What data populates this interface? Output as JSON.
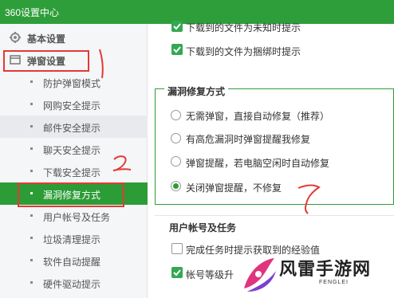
{
  "window": {
    "title": "360设置中心"
  },
  "sidebar": {
    "groups": [
      {
        "label": "基本设置",
        "icon": "gear-icon"
      },
      {
        "label": "弹窗设置",
        "icon": "window-icon"
      }
    ],
    "items": [
      {
        "label": "防护弹窗模式"
      },
      {
        "label": "网购安全提示"
      },
      {
        "label": "邮件安全提示"
      },
      {
        "label": "聊天安全提示"
      },
      {
        "label": "下载安全提示"
      },
      {
        "label": "漏洞修复方式"
      },
      {
        "label": "用户帐号及任务"
      },
      {
        "label": "垃圾清理提示"
      },
      {
        "label": "软件自动提醒"
      },
      {
        "label": "硬件驱动提示"
      }
    ],
    "active_index": 5
  },
  "main": {
    "download_options": [
      {
        "label": "下载到的文件为未知时提示",
        "checked": true
      },
      {
        "label": "下载到的文件为捆绑时提示",
        "checked": true
      }
    ],
    "vuln_section": {
      "title": "漏洞修复方式",
      "options": [
        {
          "label": "无需弹窗，直接自动修复（推荐）",
          "selected": false
        },
        {
          "label": "有高危漏洞时弹窗提醒我修复",
          "selected": false
        },
        {
          "label": "弹窗提醒，若电脑空闲时自动修复",
          "selected": false
        },
        {
          "label": "关闭弹窗提醒，不修复",
          "selected": true
        }
      ]
    },
    "account_section": {
      "title": "用户帐号及任务",
      "options": [
        {
          "label": "完成任务时提示获取到的经验值",
          "checked": false
        },
        {
          "label": "帐号等级升",
          "checked": true
        }
      ]
    }
  },
  "annotations": {
    "mark_1": "1",
    "mark_2": "2"
  },
  "watermark": {
    "text": "风雷手游网",
    "sub": "FENGLEI"
  },
  "colors": {
    "brand_green": "#2e9e3a",
    "annotation_red": "#e53935"
  }
}
